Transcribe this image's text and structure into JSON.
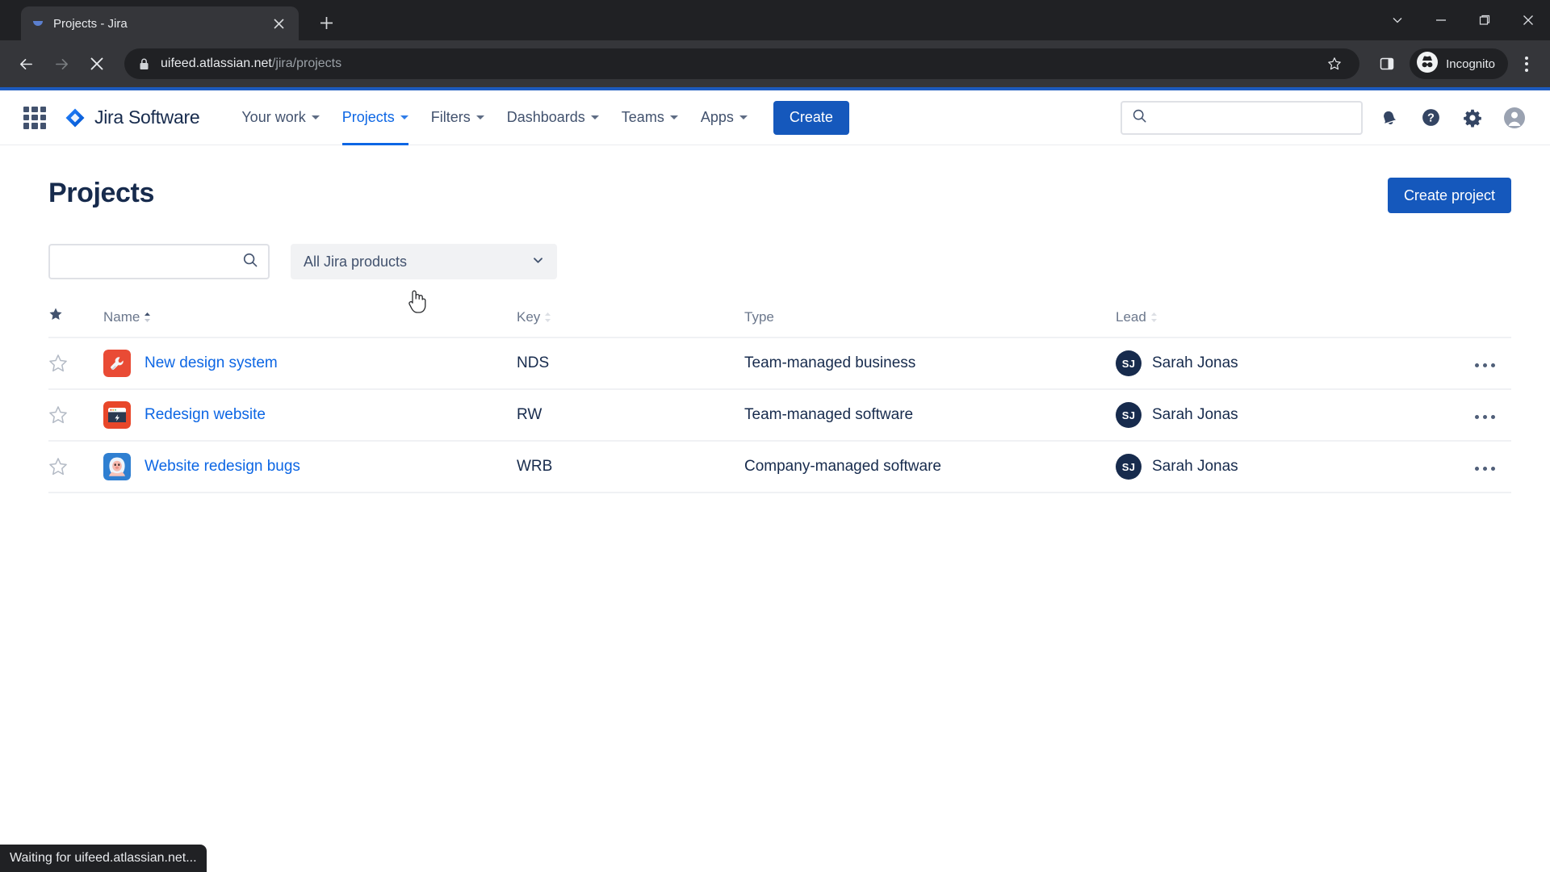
{
  "browser": {
    "tab": {
      "title": "Projects - Jira",
      "favicon_icon": "jira-favicon",
      "close_icon": "close-icon"
    },
    "new_tab_icon": "plus-icon",
    "window_controls": {
      "expand_icon": "chevron-down-icon",
      "minimize_icon": "minimize-icon",
      "maximize_icon": "maximize-icon",
      "close_icon": "close-icon"
    },
    "back_icon": "back-arrow-icon",
    "forward_icon": "forward-arrow-icon",
    "stop_icon": "stop-loading-icon",
    "lock_icon": "lock-icon",
    "url_domain": "uifeed.atlassian.net",
    "url_path": "/jira/projects",
    "bookmark_icon": "star-outline-icon",
    "side_panel_icon": "side-panel-icon",
    "incognito_icon": "incognito-icon",
    "incognito_label": "Incognito",
    "menu_icon": "three-dot-menu-icon",
    "status_text": "Waiting for uifeed.atlassian.net..."
  },
  "jira_nav": {
    "app_switcher_icon": "app-switcher-grid-icon",
    "logo_icon": "jira-diamond-logo-icon",
    "product_name": "Jira Software",
    "items": [
      {
        "label": "Your work",
        "active": false
      },
      {
        "label": "Projects",
        "active": true
      },
      {
        "label": "Filters",
        "active": false
      },
      {
        "label": "Dashboards",
        "active": false
      },
      {
        "label": "Teams",
        "active": false
      },
      {
        "label": "Apps",
        "active": false
      }
    ],
    "create_label": "Create",
    "search": {
      "placeholder": "",
      "value": "",
      "icon": "search-icon"
    },
    "notifications_icon": "bell-icon",
    "help_icon": "help-circle-icon",
    "settings_icon": "gear-icon",
    "profile_icon": "account-avatar-icon"
  },
  "main": {
    "title": "Projects",
    "create_project_label": "Create project",
    "search": {
      "placeholder": "",
      "value": "",
      "icon": "search-icon"
    },
    "product_filter": {
      "value": "All Jira products",
      "chevron_icon": "chevron-down-icon"
    },
    "table": {
      "headers": {
        "star": "",
        "star_icon": "star-filled-icon",
        "name": "Name",
        "key": "Key",
        "type": "Type",
        "lead": "Lead"
      },
      "sort": {
        "column": "Name",
        "direction": "asc"
      },
      "rows": [
        {
          "starred": false,
          "star_icon": "star-outline-icon",
          "avatar_icon": "wrench-project-icon",
          "avatar_color": "#e94b35",
          "name": "New design system",
          "key": "NDS",
          "type": "Team-managed business",
          "lead": "Sarah Jonas",
          "lead_initials": "SJ",
          "more_icon": "more-actions-icon"
        },
        {
          "starred": false,
          "star_icon": "star-outline-icon",
          "avatar_icon": "browser-bolt-project-icon",
          "avatar_color": "#e8472a",
          "name": "Redesign website",
          "key": "RW",
          "type": "Team-managed software",
          "lead": "Sarah Jonas",
          "lead_initials": "SJ",
          "more_icon": "more-actions-icon"
        },
        {
          "starred": false,
          "star_icon": "star-outline-icon",
          "avatar_icon": "yeti-project-icon",
          "avatar_color": "#2f7fd1",
          "name": "Website redesign bugs",
          "key": "WRB",
          "type": "Company-managed software",
          "lead": "Sarah Jonas",
          "lead_initials": "SJ",
          "more_icon": "more-actions-icon"
        }
      ]
    }
  },
  "colors": {
    "brand_blue": "#0c66e4",
    "button_blue": "#1558bc",
    "text_dark": "#172b4d",
    "text_muted": "#6b778c",
    "loading_bar": "#1d5bbf"
  }
}
